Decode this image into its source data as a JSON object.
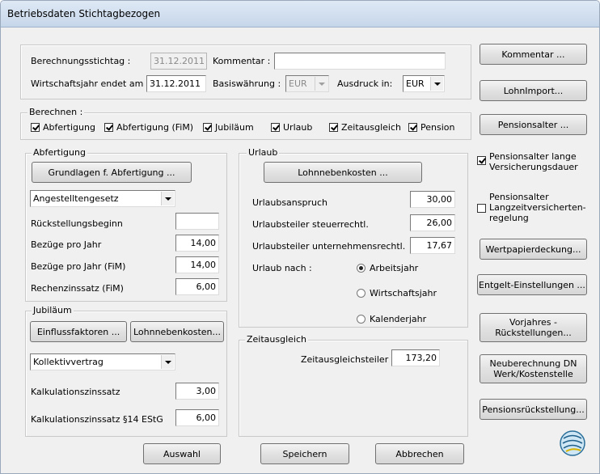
{
  "window": {
    "title": "Betriebsdaten Stichtagbezogen"
  },
  "header": {
    "stichtag_label": "Berechnungsstichtag :",
    "stichtag_value": "31.12.2011",
    "kommentar_label": "Kommentar :",
    "kommentar_value": "",
    "wj_label": "Wirtschaftsjahr endet am :",
    "wj_value": "31.12.2011",
    "basis_label": "Basiswährung :",
    "basis_value": "EUR",
    "ausdruck_label": "Ausdruck in:",
    "ausdruck_value": "EUR"
  },
  "berechnen": {
    "legend": "Berechnen :",
    "items": [
      {
        "label": "Abfertigung",
        "checked": true
      },
      {
        "label": "Abfertigung (FiM)",
        "checked": true
      },
      {
        "label": "Jubiläum",
        "checked": true
      },
      {
        "label": "Urlaub",
        "checked": true
      },
      {
        "label": "Zeitausgleich",
        "checked": true
      },
      {
        "label": "Pension",
        "checked": true
      }
    ]
  },
  "abfertigung": {
    "legend": "Abfertigung",
    "grundlagen_button": "Grundlagen f. Abfertigung ...",
    "gesetz_value": "Angestelltengesetz",
    "rueckstellungsbeginn_label": "Rückstellungsbeginn",
    "rueckstellungsbeginn_value": "",
    "bezuege_label": "Bezüge pro Jahr",
    "bezuege_value": "14,00",
    "bezuege_fim_label": "Bezüge pro Jahr (FiM)",
    "bezuege_fim_value": "14,00",
    "zins_label": "Rechenzinssatz (FiM)",
    "zins_value": "6,00"
  },
  "jubilaeum": {
    "legend": "Jubiläum",
    "einfluss_button": "Einflussfaktoren ...",
    "lohnneben_button": "Lohnnebenkosten...",
    "vertrag_value": "Kollektivvertrag",
    "kalk_label": "Kalkulationszinssatz",
    "kalk_value": "3,00",
    "kalk14_label": "Kalkulationszinssatz §14 EStG",
    "kalk14_value": "6,00"
  },
  "urlaub": {
    "legend": "Urlaub",
    "lohnneben_button": "Lohnnebenkosten ...",
    "anspruch_label": "Urlaubsanspruch",
    "anspruch_value": "30,00",
    "steuer_label": "Urlaubsteiler steuerrechtl.",
    "steuer_value": "26,00",
    "unternehmen_label": "Urlaubsteiler unternehmensrechtl.",
    "unternehmen_value": "17,67",
    "nach_label": "Urlaub nach :",
    "options": [
      {
        "label": "Arbeitsjahr",
        "selected": true
      },
      {
        "label": "Wirtschaftsjahr",
        "selected": false
      },
      {
        "label": "Kalenderjahr",
        "selected": false
      }
    ]
  },
  "zeitausgleich": {
    "legend": "Zeitausgleich",
    "teiler_label": "Zeitausgleichsteiler",
    "teiler_value": "173,20"
  },
  "sidebar": {
    "kommentar_button": "Kommentar ...",
    "lohnimport_button": "LohnImport...",
    "pensionsalter_button": "Pensionsalter ...",
    "lange_label": "Pensionsalter lange Versicherungsdauer",
    "lange_checked": true,
    "langzeit_label": "Pensionsalter Langzeitversicherten-regelung",
    "langzeit_checked": false,
    "wertpapier_button": "Wertpapierdeckung...",
    "entgelt_button": "Entgelt-Einstellungen ...",
    "vorjahres_button": "Vorjahres - Rückstellungen...",
    "neuberechnung_button": "Neuberechnung DN Werk/Kostenstelle",
    "pensionsrueck_button": "Pensionsrückstellung..."
  },
  "footer": {
    "auswahl_button": "Auswahl",
    "speichern_button": "Speichern",
    "abbrechen_button": "Abbrechen"
  }
}
